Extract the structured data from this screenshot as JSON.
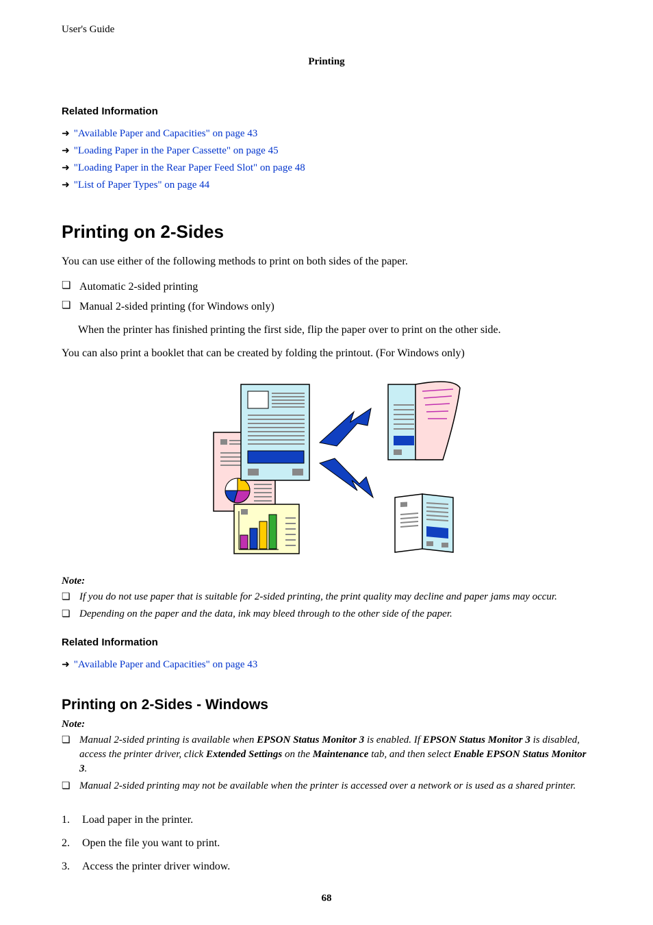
{
  "header": {
    "guide": "User's Guide",
    "section": "Printing"
  },
  "ri1": {
    "heading": "Related Information",
    "links": [
      "\"Available Paper and Capacities\" on page 43",
      "\"Loading Paper in the Paper Cassette\" on page 45",
      "\"Loading Paper in the Rear Paper Feed Slot\" on page 48",
      "\"List of Paper Types\" on page 44"
    ]
  },
  "s1": {
    "title": "Printing on 2-Sides",
    "intro": "You can use either of the following methods to print on both sides of the paper.",
    "methods": [
      "Automatic 2-sided printing",
      "Manual 2-sided printing (for Windows only)"
    ],
    "sub": "When the printer has finished printing the first side, flip the paper over to print on the other side.",
    "booklet": "You can also print a booklet that can be created by folding the printout. (For Windows only)"
  },
  "note1": {
    "heading": "Note:",
    "items": [
      "If you do not use paper that is suitable for 2-sided printing, the print quality may decline and paper jams may occur.",
      "Depending on the paper and the data, ink may bleed through to the other side of the paper."
    ]
  },
  "ri2": {
    "heading": "Related Information",
    "links": [
      "\"Available Paper and Capacities\" on page 43"
    ]
  },
  "s2": {
    "title": "Printing on 2-Sides - Windows",
    "noteHeading": "Note:",
    "note_a_pre": "Manual 2-sided printing is available when ",
    "note_a_b1": "EPSON Status Monitor 3",
    "note_a_mid1": " is enabled. If ",
    "note_a_b2": "EPSON Status Monitor 3",
    "note_a_mid2": " is disabled, access the printer driver, click ",
    "note_a_b3": "Extended Settings",
    "note_a_mid3": " on the ",
    "note_a_b4": "Maintenance",
    "note_a_mid4": " tab, and then select ",
    "note_a_b5": "Enable EPSON Status Monitor 3",
    "note_a_post": ".",
    "note_b": "Manual 2-sided printing may not be available when the printer is accessed over a network or is used as a shared printer.",
    "steps": [
      "Load paper in the printer.",
      "Open the file you want to print.",
      "Access the printer driver window."
    ]
  },
  "pageNumber": "68"
}
